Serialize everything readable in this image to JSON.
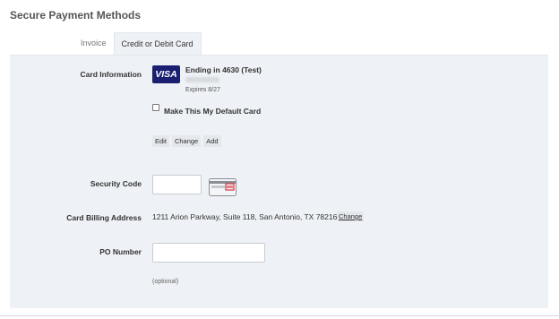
{
  "page": {
    "title": "Secure Payment Methods"
  },
  "tabs": [
    {
      "label": "Invoice",
      "active": false
    },
    {
      "label": "Credit or Debit Card",
      "active": true
    }
  ],
  "card_info": {
    "label": "Card Information",
    "brand": "VISA",
    "ending_text": "Ending in 4630 (Test)",
    "expires": "Expires 8/27",
    "default_checkbox_label": "Make This My Default Card",
    "default_checked": false,
    "actions": [
      "Edit",
      "Change",
      "Add"
    ]
  },
  "security_code": {
    "label": "Security Code",
    "value": "",
    "icon": "cvv-card-icon"
  },
  "billing": {
    "label": "Card Billing Address",
    "address": "1211 Arion Parkway, Suite 118, San Antonio, TX 78216",
    "change_label": "Change"
  },
  "po_number": {
    "label": "PO Number",
    "value": "",
    "hint": "(optional)"
  },
  "colors": {
    "panel_bg": "#eef1f5",
    "visa_blue": "#1a1f71",
    "cvv_red": "#d9363e"
  }
}
